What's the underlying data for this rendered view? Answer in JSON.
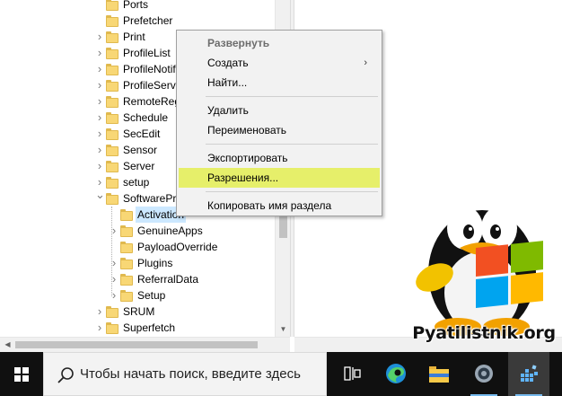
{
  "tree": {
    "items": [
      {
        "label": "Ports",
        "expander": "none",
        "indent": 0
      },
      {
        "label": "Prefetcher",
        "expander": "none",
        "indent": 0
      },
      {
        "label": "Print",
        "expander": "collapsed",
        "indent": 0
      },
      {
        "label": "ProfileList",
        "expander": "collapsed",
        "indent": 0
      },
      {
        "label": "ProfileNotification",
        "expander": "collapsed",
        "indent": 0
      },
      {
        "label": "ProfileService",
        "expander": "collapsed",
        "indent": 0
      },
      {
        "label": "RemoteRegistry",
        "expander": "collapsed",
        "indent": 0
      },
      {
        "label": "Schedule",
        "expander": "collapsed",
        "indent": 0
      },
      {
        "label": "SecEdit",
        "expander": "collapsed",
        "indent": 0
      },
      {
        "label": "Sensor",
        "expander": "collapsed",
        "indent": 0
      },
      {
        "label": "Server",
        "expander": "collapsed",
        "indent": 0
      },
      {
        "label": "setup",
        "expander": "collapsed",
        "indent": 0
      },
      {
        "label": "SoftwareProtectionPlatform",
        "expander": "expanded",
        "indent": 0
      },
      {
        "label": "Activation",
        "expander": "none",
        "indent": 1,
        "selected": true
      },
      {
        "label": "GenuineApps",
        "expander": "collapsed",
        "indent": 1
      },
      {
        "label": "PayloadOverride",
        "expander": "none",
        "indent": 1
      },
      {
        "label": "Plugins",
        "expander": "collapsed",
        "indent": 1
      },
      {
        "label": "ReferralData",
        "expander": "collapsed",
        "indent": 1
      },
      {
        "label": "Setup",
        "expander": "collapsed",
        "indent": 1
      },
      {
        "label": "SRUM",
        "expander": "collapsed",
        "indent": 0
      },
      {
        "label": "Superfetch",
        "expander": "collapsed",
        "indent": 0
      }
    ]
  },
  "context_menu": {
    "items": [
      {
        "label": "Развернуть",
        "type": "bold"
      },
      {
        "label": "Создать",
        "type": "submenu"
      },
      {
        "label": "Найти...",
        "type": "item"
      },
      {
        "type": "separator"
      },
      {
        "label": "Удалить",
        "type": "item"
      },
      {
        "label": "Переименовать",
        "type": "item"
      },
      {
        "type": "separator"
      },
      {
        "label": "Экспортировать",
        "type": "item"
      },
      {
        "label": "Разрешения...",
        "type": "highlight"
      },
      {
        "type": "separator"
      },
      {
        "label": "Копировать имя раздела",
        "type": "item"
      }
    ],
    "submenu_arrow": "›",
    "highlight_color": "#e6ef6a"
  },
  "watermark": {
    "text": "Pyatilistnik.org"
  },
  "taskbar": {
    "search_placeholder": "Чтобы начать поиск, введите здесь",
    "icons": [
      {
        "name": "task-view-icon"
      },
      {
        "name": "edge-icon"
      },
      {
        "name": "file-explorer-icon"
      },
      {
        "name": "settings-gear-icon"
      },
      {
        "name": "registry-editor-icon",
        "active": true
      }
    ]
  }
}
